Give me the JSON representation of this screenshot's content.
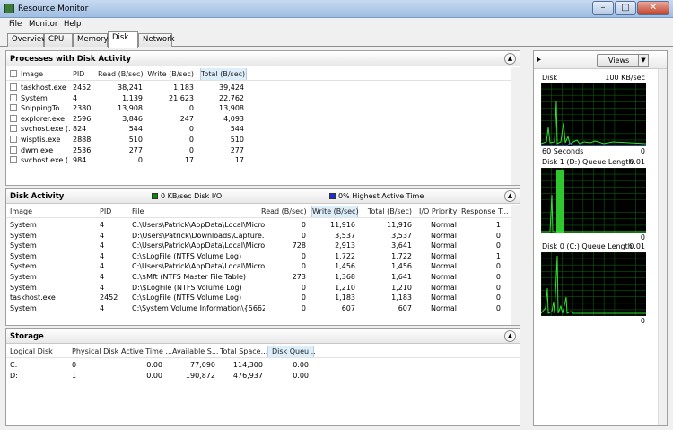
{
  "window": {
    "title": "Resource Monitor",
    "min": "–",
    "max": "□",
    "close": "✕"
  },
  "menu": [
    "File",
    "Monitor",
    "Help"
  ],
  "tabs": [
    "Overview",
    "CPU",
    "Memory",
    "Disk",
    "Network"
  ],
  "active_tab": "Disk",
  "processes": {
    "title": "Processes with Disk Activity",
    "columns": [
      "Image",
      "PID",
      "Read (B/sec)",
      "Write (B/sec)",
      "Total (B/sec)"
    ],
    "rows": [
      [
        "taskhost.exe",
        "2452",
        "38,241",
        "1,183",
        "39,424"
      ],
      [
        "System",
        "4",
        "1,139",
        "21,623",
        "22,762"
      ],
      [
        "SnippingTo...",
        "2380",
        "13,908",
        "0",
        "13,908"
      ],
      [
        "explorer.exe",
        "2596",
        "3,846",
        "247",
        "4,093"
      ],
      [
        "svchost.exe (...",
        "824",
        "544",
        "0",
        "544"
      ],
      [
        "wisptis.exe",
        "2888",
        "510",
        "0",
        "510"
      ],
      [
        "dwm.exe",
        "2536",
        "277",
        "0",
        "277"
      ],
      [
        "svchost.exe (...",
        "984",
        "0",
        "17",
        "17"
      ]
    ]
  },
  "disk_activity": {
    "title": "Disk Activity",
    "legend1": "0 KB/sec Disk I/O",
    "legend1_color": "#0a8a0a",
    "legend2": "0% Highest Active Time",
    "legend2_color": "#1e2ed6",
    "columns": [
      "Image",
      "PID",
      "File",
      "Read (B/sec)",
      "Write (B/sec)",
      "Total (B/sec)",
      "I/O Priority",
      "Response T..."
    ],
    "rows": [
      [
        "System",
        "4",
        "C:\\Users\\Patrick\\AppData\\Local\\Micro...",
        "0",
        "11,916",
        "11,916",
        "Normal",
        "1"
      ],
      [
        "System",
        "4",
        "D:\\Users\\Patrick\\Downloads\\Capture....",
        "0",
        "3,537",
        "3,537",
        "Normal",
        "0"
      ],
      [
        "System",
        "4",
        "C:\\Users\\Patrick\\AppData\\Local\\Micro...",
        "728",
        "2,913",
        "3,641",
        "Normal",
        "0"
      ],
      [
        "System",
        "4",
        "C:\\$LogFile (NTFS Volume Log)",
        "0",
        "1,722",
        "1,722",
        "Normal",
        "1"
      ],
      [
        "System",
        "4",
        "C:\\Users\\Patrick\\AppData\\Local\\Micro...",
        "0",
        "1,456",
        "1,456",
        "Normal",
        "0"
      ],
      [
        "System",
        "4",
        "C:\\$Mft (NTFS Master File Table)",
        "273",
        "1,368",
        "1,641",
        "Normal",
        "0"
      ],
      [
        "System",
        "4",
        "D:\\$LogFile (NTFS Volume Log)",
        "0",
        "1,210",
        "1,210",
        "Normal",
        "0"
      ],
      [
        "taskhost.exe",
        "2452",
        "C:\\$LogFile (NTFS Volume Log)",
        "0",
        "1,183",
        "1,183",
        "Normal",
        "0"
      ],
      [
        "System",
        "4",
        "C:\\System Volume Information\\{56629...",
        "0",
        "607",
        "607",
        "Normal",
        "0"
      ]
    ]
  },
  "storage": {
    "title": "Storage",
    "columns": [
      "Logical Disk",
      "Physical Disk",
      "Active Time ...",
      "Available S...",
      "Total Space...",
      "Disk Queu..."
    ],
    "rows": [
      [
        "C:",
        "0",
        "0.00",
        "77,090",
        "114,300",
        "0.00"
      ],
      [
        "D:",
        "1",
        "0.00",
        "190,872",
        "476,937",
        "0.00"
      ]
    ]
  },
  "side": {
    "views_label": "Views",
    "graph1": {
      "label": "Disk",
      "max": "100 KB/sec",
      "time": "60 Seconds",
      "min": "0"
    },
    "graph2": {
      "label": "Disk 1 (D:) Queue Length",
      "max": "0.01",
      "min": "0"
    },
    "graph3": {
      "label": "Disk 0 (C:) Queue Length",
      "max": "0.01",
      "min": "0"
    }
  }
}
